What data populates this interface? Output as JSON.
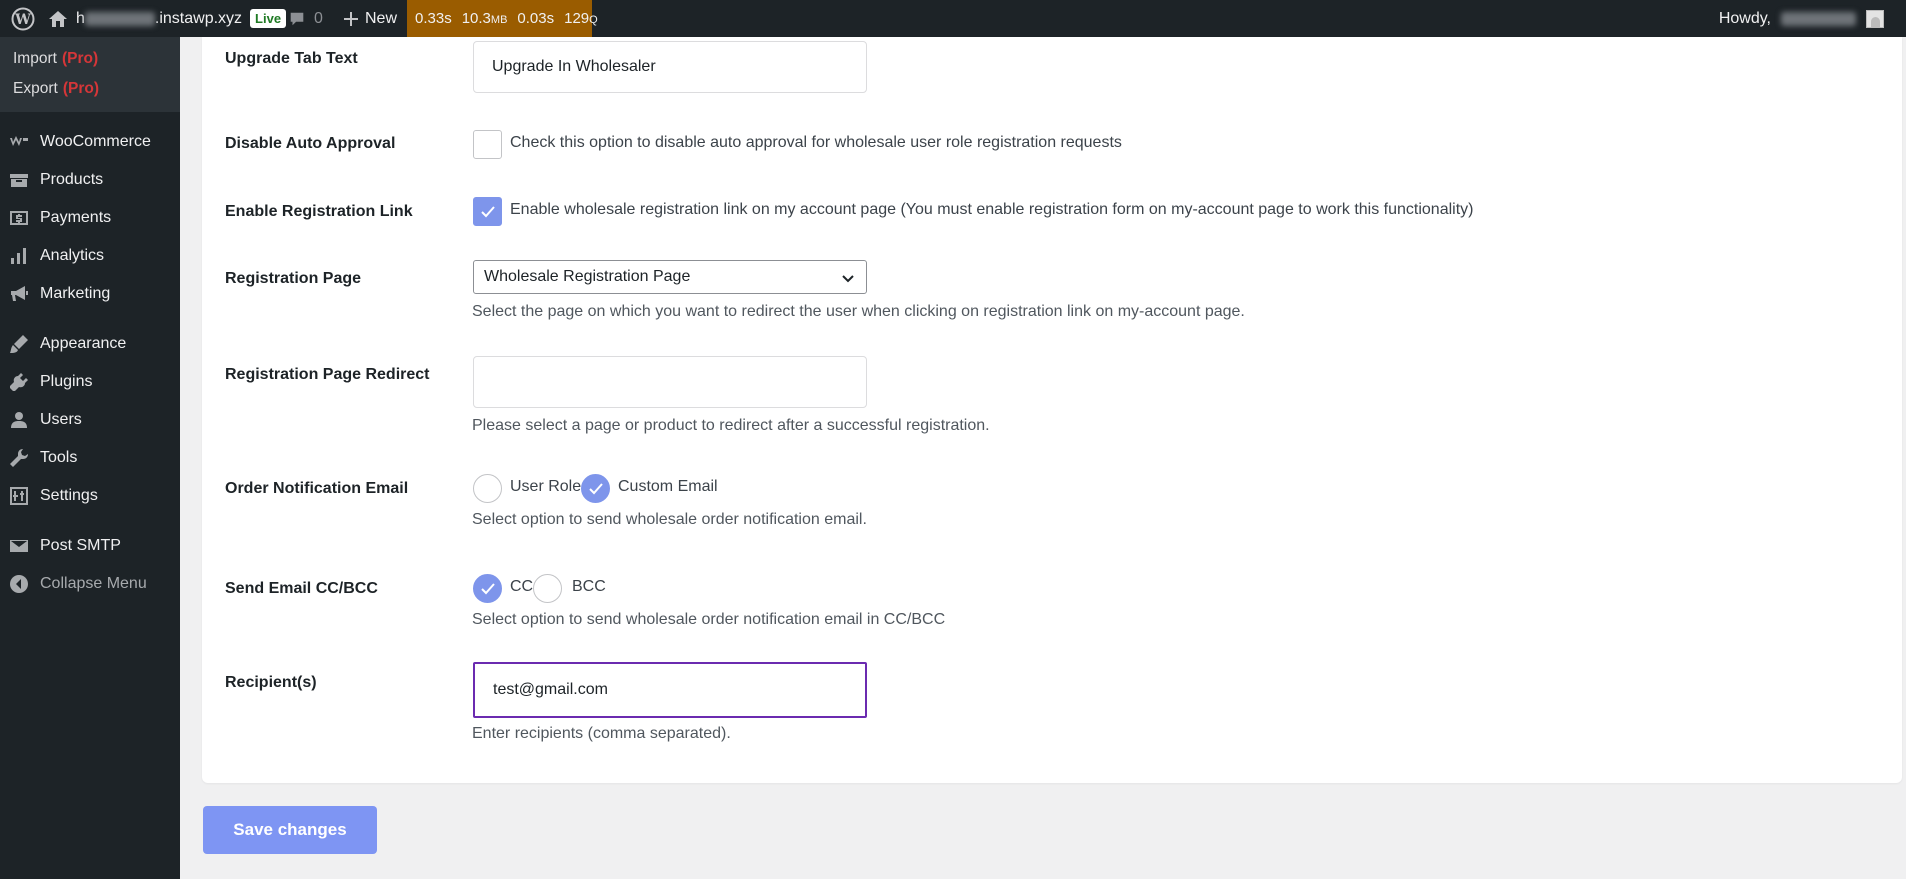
{
  "adminbar": {
    "site_prefix": "h",
    "site_suffix": ".instawp.xyz",
    "live": "Live",
    "comments_count": "0",
    "new_label": "New",
    "perf": {
      "time1": "0.33s",
      "mem": "10.3",
      "mem_unit": "MB",
      "time2": "0.03s",
      "queries": "129",
      "queries_unit": "Q"
    },
    "howdy": "Howdy,"
  },
  "sidebar": {
    "submenu": [
      {
        "label": "Import",
        "badge": "(Pro)"
      },
      {
        "label": "Export",
        "badge": "(Pro)"
      }
    ],
    "items": [
      {
        "label": "WooCommerce",
        "icon": "woocommerce-icon"
      },
      {
        "label": "Products",
        "icon": "products-icon"
      },
      {
        "label": "Payments",
        "icon": "payments-icon"
      },
      {
        "label": "Analytics",
        "icon": "analytics-icon"
      },
      {
        "label": "Marketing",
        "icon": "marketing-icon"
      },
      {
        "label": "Appearance",
        "icon": "appearance-icon"
      },
      {
        "label": "Plugins",
        "icon": "plugins-icon"
      },
      {
        "label": "Users",
        "icon": "users-icon"
      },
      {
        "label": "Tools",
        "icon": "tools-icon"
      },
      {
        "label": "Settings",
        "icon": "settings-icon"
      },
      {
        "label": "Post SMTP",
        "icon": "email-icon"
      },
      {
        "label": "Collapse Menu",
        "icon": "collapse-icon"
      }
    ]
  },
  "form": {
    "upgrade_tab": {
      "label": "Upgrade Tab Text",
      "value": "Upgrade In Wholesaler"
    },
    "disable_auto_approval": {
      "label": "Disable Auto Approval",
      "checked": false,
      "text": "Check this option to disable auto approval for wholesale user role registration requests"
    },
    "enable_registration_link": {
      "label": "Enable Registration Link",
      "checked": true,
      "text": "Enable wholesale registration link on my account page (You must enable registration form on my-account page to work this functionality)"
    },
    "registration_page": {
      "label": "Registration Page",
      "selected": "Wholesale Registration Page",
      "desc": "Select the page on which you want to redirect the user when clicking on registration link on my-account page."
    },
    "registration_redirect": {
      "label": "Registration Page Redirect",
      "value": "",
      "desc": "Please select a page or product to redirect after a successful registration."
    },
    "order_notification": {
      "label": "Order Notification Email",
      "option1": "User Role",
      "option2": "Custom Email",
      "selected": "Custom Email",
      "desc": "Select option to send wholesale order notification email."
    },
    "send_cc_bcc": {
      "label": "Send Email CC/BCC",
      "option1": "CC",
      "option2": "BCC",
      "selected": "CC",
      "desc": "Select option to send wholesale order notification email in CC/BCC"
    },
    "recipients": {
      "label": "Recipient(s)",
      "value": "test@gmail.com",
      "desc": "Enter recipients (comma separated)."
    }
  },
  "save_label": "Save changes",
  "colors": {
    "accent": "#7e95eb",
    "focus_border": "#6b2bb0",
    "pro": "#d63638",
    "perf_bg": "#9a5c00"
  }
}
